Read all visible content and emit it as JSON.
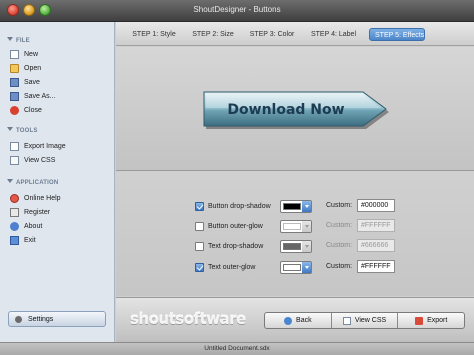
{
  "window": {
    "title": "ShoutDesigner - Buttons"
  },
  "sidebar": {
    "sections": [
      {
        "header": "FILE",
        "items": [
          "New",
          "Open",
          "Save",
          "Save As...",
          "Close"
        ]
      },
      {
        "header": "TOOLS",
        "items": [
          "Export Image",
          "View CSS"
        ]
      },
      {
        "header": "APPLICATION",
        "items": [
          "Online Help",
          "Register",
          "About",
          "Exit"
        ]
      }
    ],
    "settings_label": "Settings"
  },
  "tabs": [
    {
      "label": "STEP 1: Style"
    },
    {
      "label": "STEP 2: Size"
    },
    {
      "label": "STEP 3: Color"
    },
    {
      "label": "STEP 4: Label"
    },
    {
      "label": "STEP 5: Effects",
      "active": true
    }
  ],
  "preview": {
    "button_label": "Download Now",
    "button_color": "#6fa3b4"
  },
  "effects": {
    "custom_label": "Custom:",
    "rows": [
      {
        "label": "Button drop-shadow",
        "checked": true,
        "color": "#000000",
        "value": "#000000",
        "enabled": true
      },
      {
        "label": "Button outer-glow",
        "checked": false,
        "color": "#FFFFFF",
        "value": "#FFFFFF",
        "enabled": false
      },
      {
        "label": "Text drop-shadow",
        "checked": false,
        "color": "#666666",
        "value": "#666666",
        "enabled": false
      },
      {
        "label": "Text outer-glow",
        "checked": true,
        "color": "#FFFFFF",
        "value": "#FFFFFF",
        "enabled": true
      }
    ]
  },
  "bottom": {
    "logo": "shoutsoftware",
    "back_label": "Back",
    "view_css_label": "View CSS",
    "export_label": "Export"
  },
  "status": {
    "document": "Untitled Document.sdx"
  },
  "colors": {
    "accent": "#4d86c9",
    "sidebar_bg": "#dfe6ee"
  }
}
